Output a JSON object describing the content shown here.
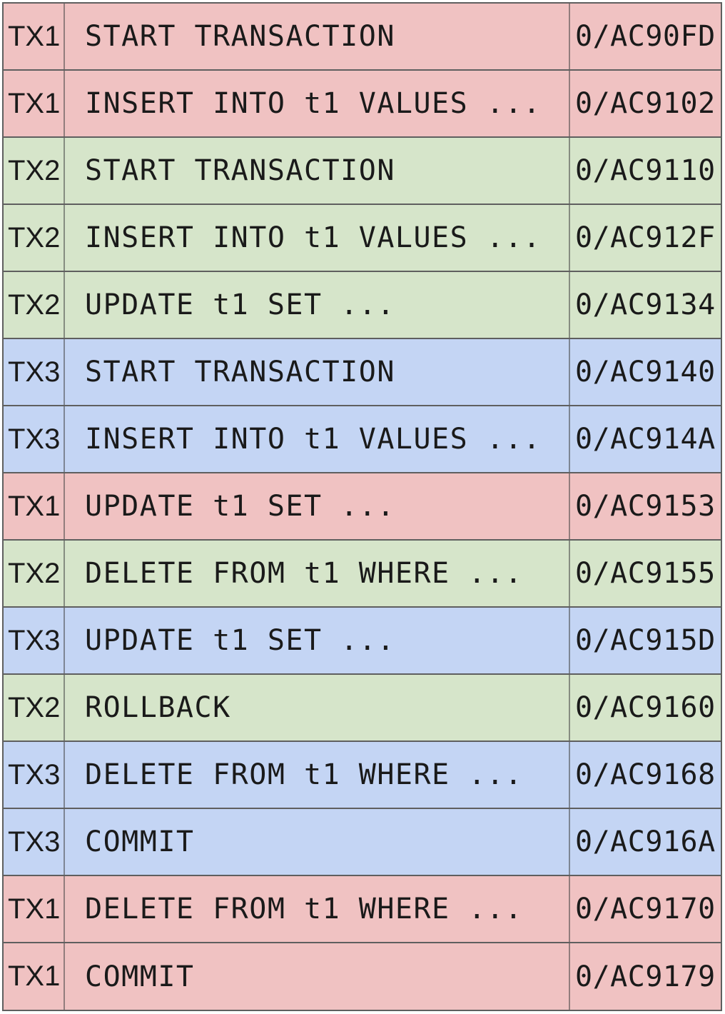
{
  "colors": {
    "TX1": "#f0c2c2",
    "TX2": "#d6e5ca",
    "TX3": "#c4d5f4",
    "border": "#5f5f5f"
  },
  "rows": [
    {
      "tx": "TX1",
      "statement": "START TRANSACTION",
      "lsn": "0/AC90FD"
    },
    {
      "tx": "TX1",
      "statement": "INSERT INTO t1 VALUES ...",
      "lsn": "0/AC9102"
    },
    {
      "tx": "TX2",
      "statement": "START TRANSACTION",
      "lsn": "0/AC9110"
    },
    {
      "tx": "TX2",
      "statement": "INSERT INTO t1 VALUES ...",
      "lsn": "0/AC912F"
    },
    {
      "tx": "TX2",
      "statement": "UPDATE t1 SET ...",
      "lsn": "0/AC9134"
    },
    {
      "tx": "TX3",
      "statement": "START TRANSACTION",
      "lsn": "0/AC9140"
    },
    {
      "tx": "TX3",
      "statement": "INSERT INTO t1 VALUES ...",
      "lsn": "0/AC914A"
    },
    {
      "tx": "TX1",
      "statement": "UPDATE t1 SET ...",
      "lsn": "0/AC9153"
    },
    {
      "tx": "TX2",
      "statement": "DELETE FROM t1 WHERE ...",
      "lsn": "0/AC9155"
    },
    {
      "tx": "TX3",
      "statement": "UPDATE t1 SET ...",
      "lsn": "0/AC915D"
    },
    {
      "tx": "TX2",
      "statement": "ROLLBACK",
      "lsn": "0/AC9160"
    },
    {
      "tx": "TX3",
      "statement": "DELETE FROM t1 WHERE ...",
      "lsn": "0/AC9168"
    },
    {
      "tx": "TX3",
      "statement": "COMMIT",
      "lsn": "0/AC916A"
    },
    {
      "tx": "TX1",
      "statement": "DELETE FROM t1 WHERE ...",
      "lsn": "0/AC9170"
    },
    {
      "tx": "TX1",
      "statement": "COMMIT",
      "lsn": "0/AC9179"
    }
  ]
}
